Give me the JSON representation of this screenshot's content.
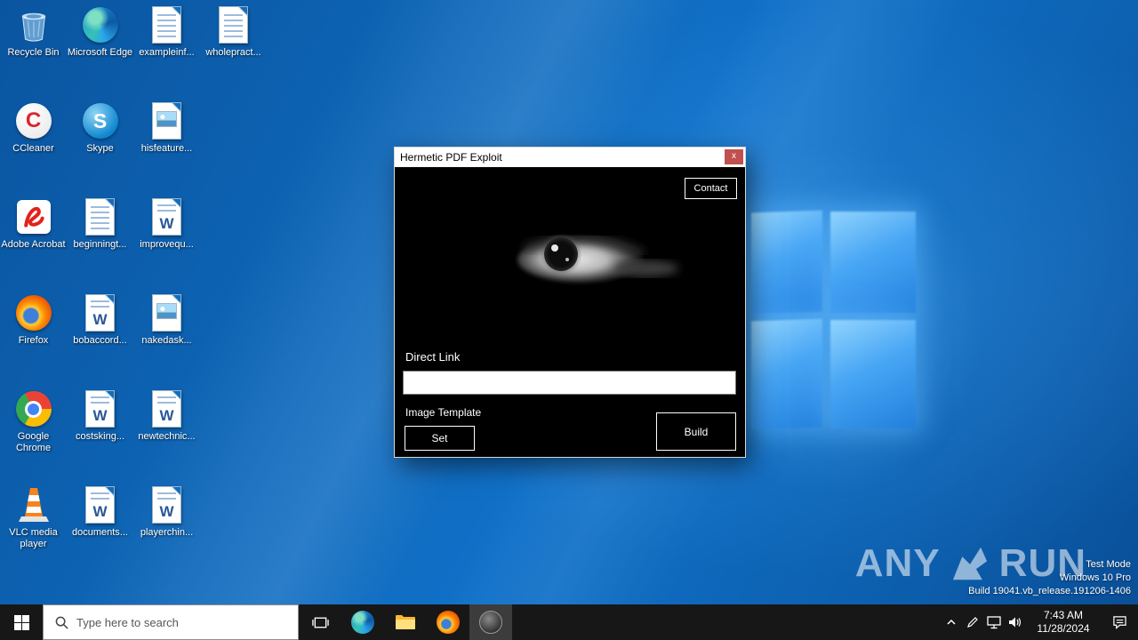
{
  "colors": {
    "desktop_blue": "#0e67ba",
    "logo_blue": "#4baaf8",
    "taskbar_bg": "#171717",
    "close_button_red": "#c0504d",
    "window_body": "#000000",
    "title_bar": "#ffffff"
  },
  "desktop": {
    "icons": [
      {
        "name": "recycle-bin",
        "label": "Recycle Bin",
        "type": "recycle",
        "row": 1,
        "col": 1
      },
      {
        "name": "microsoft-edge",
        "label": "Microsoft Edge",
        "type": "edge",
        "row": 1,
        "col": 2
      },
      {
        "name": "exampleinf",
        "label": "exampleinf...",
        "type": "doc",
        "row": 1,
        "col": 3
      },
      {
        "name": "wholepract",
        "label": "wholepract...",
        "type": "doc",
        "row": 1,
        "col": 4
      },
      {
        "name": "ccleaner",
        "label": "CCleaner",
        "type": "ccleaner",
        "row": 2,
        "col": 1
      },
      {
        "name": "skype",
        "label": "Skype",
        "type": "skype",
        "row": 2,
        "col": 2
      },
      {
        "name": "hisfeature",
        "label": "hisfeature...",
        "type": "image",
        "row": 2,
        "col": 3
      },
      {
        "name": "adobe-acrobat",
        "label": "Adobe Acrobat",
        "type": "acrobat",
        "row": 3,
        "col": 1
      },
      {
        "name": "beginningt",
        "label": "beginningt...",
        "type": "doc",
        "row": 3,
        "col": 2
      },
      {
        "name": "improvequ",
        "label": "improvequ...",
        "type": "word",
        "row": 3,
        "col": 3
      },
      {
        "name": "firefox",
        "label": "Firefox",
        "type": "firefox",
        "row": 4,
        "col": 1
      },
      {
        "name": "bobaccord",
        "label": "bobaccord...",
        "type": "word",
        "row": 4,
        "col": 2
      },
      {
        "name": "nakedask",
        "label": "nakedask...",
        "type": "image",
        "row": 4,
        "col": 3
      },
      {
        "name": "google-chrome",
        "label": "Google Chrome",
        "type": "chrome",
        "row": 5,
        "col": 1
      },
      {
        "name": "costsking",
        "label": "costsking...",
        "type": "word",
        "row": 5,
        "col": 2
      },
      {
        "name": "newtechnic",
        "label": "newtechnic...",
        "type": "word",
        "row": 5,
        "col": 3
      },
      {
        "name": "vlc",
        "label": "VLC media player",
        "type": "vlc",
        "row": 6,
        "col": 1
      },
      {
        "name": "documents",
        "label": "documents...",
        "type": "word",
        "row": 6,
        "col": 2
      },
      {
        "name": "playerchin",
        "label": "playerchin...",
        "type": "word",
        "row": 6,
        "col": 3
      }
    ]
  },
  "window": {
    "title": "Hermetic PDF Exploit",
    "close_glyph": "x",
    "contact_button": "Contact",
    "direct_link_label": "Direct Link",
    "direct_link_value": "",
    "image_template_label": "Image Template",
    "set_button": "Set",
    "build_button": "Build"
  },
  "watermark": {
    "brand_left": "ANY",
    "brand_right": "RUN",
    "line1": "Test Mode",
    "line2": "Windows 10 Pro",
    "line3": "Build 19041.vb_release.191206-1406"
  },
  "taskbar": {
    "search_placeholder": "Type here to search",
    "clock": {
      "time": "7:43 AM",
      "date": "11/28/2024"
    }
  }
}
